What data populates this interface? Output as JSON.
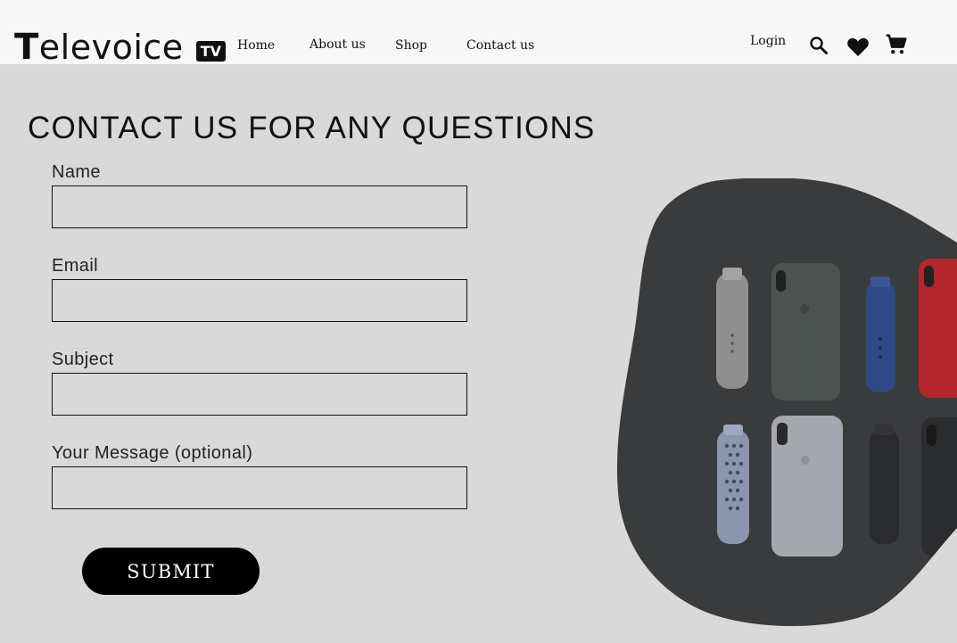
{
  "brand": {
    "first_letter": "T",
    "rest": "elevoice",
    "badge": "TV"
  },
  "nav": {
    "home": "Home",
    "about": "About us",
    "shop": "Shop",
    "contact": "Contact us",
    "login": "Login"
  },
  "icons": {
    "search": "search-icon",
    "wishlist": "heart-icon",
    "cart": "cart-icon"
  },
  "page": {
    "title": "CONTACT US FOR ANY QUESTIONS"
  },
  "form": {
    "name_label": "Name",
    "name_value": "",
    "email_label": "Email",
    "email_value": "",
    "subject_label": "Subject",
    "subject_value": "",
    "message_label": "Your Message (optional)",
    "message_value": "",
    "submit_label": "SUBMIT"
  },
  "colors": {
    "header_bg": "#f7f7f7",
    "page_bg": "#d9d9d9",
    "button_bg": "#000000",
    "hero_blob": "#3a3b3d"
  }
}
